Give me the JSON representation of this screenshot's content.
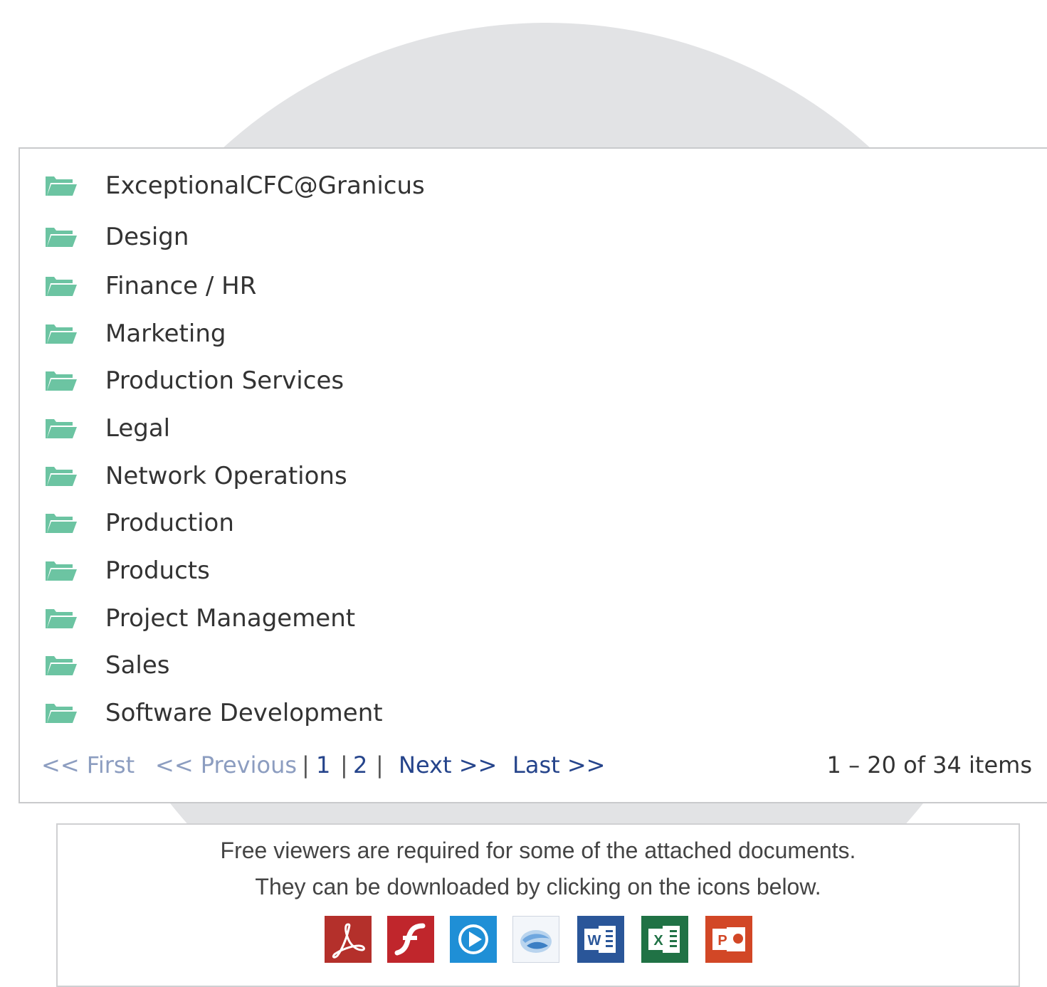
{
  "folders": [
    {
      "label": "ExceptionalCFC@Granicus"
    },
    {
      "label": "Design"
    },
    {
      "label": "Finance / HR"
    },
    {
      "label": "Marketing"
    },
    {
      "label": "Production Services"
    },
    {
      "label": "Legal"
    },
    {
      "label": "Network Operations"
    },
    {
      "label": "Production"
    },
    {
      "label": "Products"
    },
    {
      "label": "Project Management"
    },
    {
      "label": "Sales"
    },
    {
      "label": "Software Development"
    }
  ],
  "pager": {
    "first": "<< First",
    "previous": "<< Previous",
    "page1": "1",
    "page2": "2",
    "next": "Next >>",
    "last": "Last >>",
    "separator": "|"
  },
  "item_count": "1 – 20 of 34 items",
  "viewers": {
    "line1": "Free viewers are required for some of the attached documents.",
    "line2": "They can be downloaded by clicking on the icons below.",
    "icons": [
      "pdf-reader-icon",
      "flash-player-icon",
      "media-player-icon",
      "silverlight-icon",
      "word-viewer-icon",
      "excel-viewer-icon",
      "powerpoint-viewer-icon"
    ]
  },
  "colors": {
    "folder": "#6cc4a2",
    "link_active": "#25448b",
    "link_disabled": "#8c9dc0",
    "pdf": "#b4302b",
    "flash": "#c0262c",
    "media": "#1f8fd6",
    "word": "#2a5699",
    "excel": "#207245",
    "powerpoint": "#d24726"
  }
}
